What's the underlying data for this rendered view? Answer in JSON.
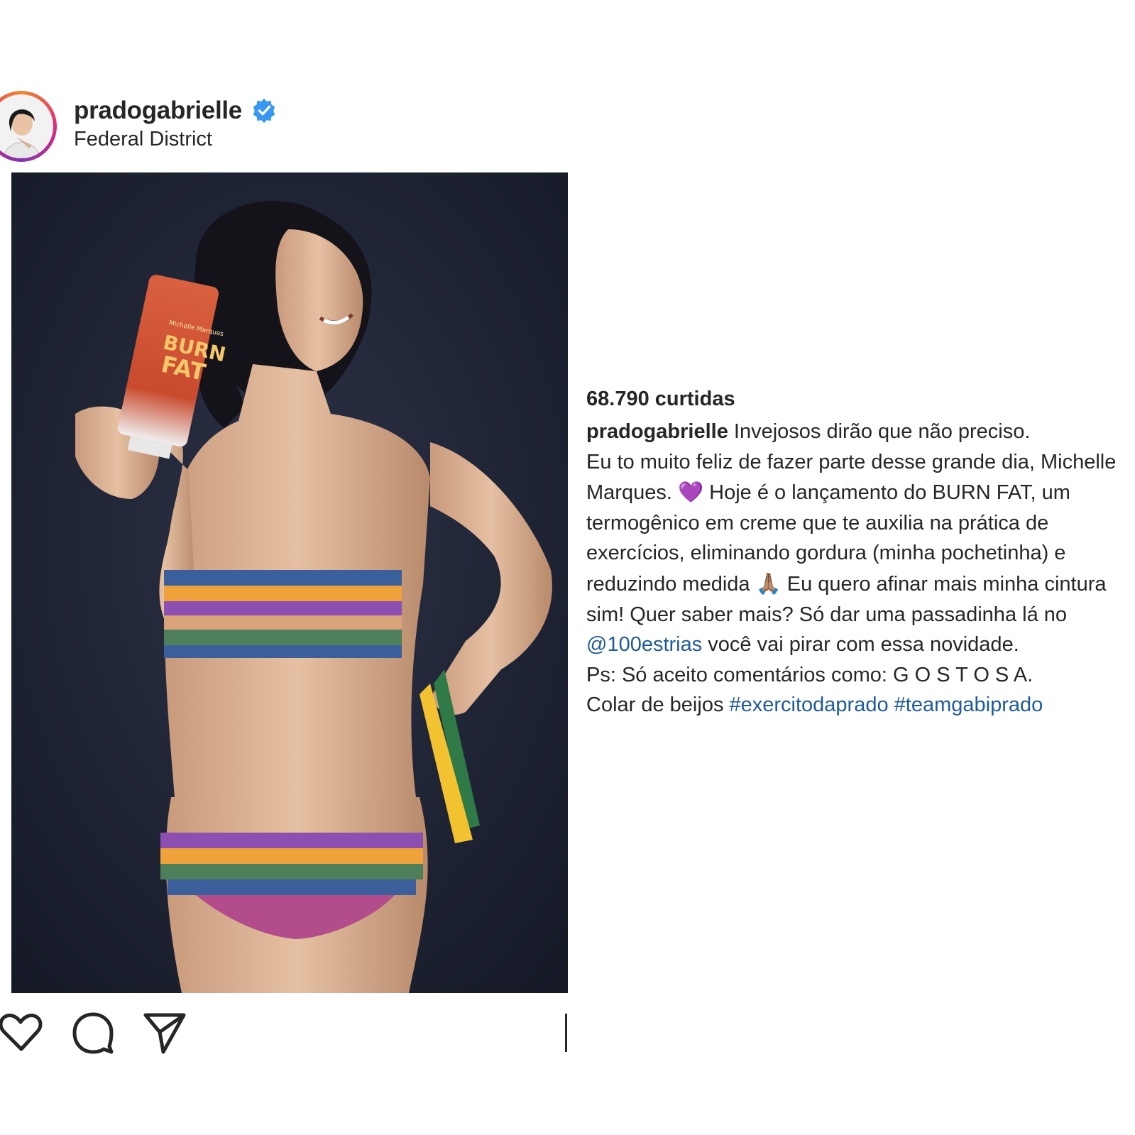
{
  "post": {
    "username": "pradogabrielle",
    "location": "Federal District",
    "verified": true,
    "likes": "68.790 curtidas",
    "caption": {
      "user": "pradogabrielle",
      "line1": " Invejosos dirão que não preciso.",
      "line2": "Eu to muito feliz de fazer parte desse grande dia, Michelle Marques. ",
      "heart_emoji": "💜",
      "line3": " Hoje é o lançamento do BURN FAT, um termogênico em creme que te auxilia na prática de exercícios, eliminando gordura (minha pochetinha) e reduzindo medida ",
      "pray_emoji": "🙏🏽",
      "line4": " Eu quero afinar mais minha cintura sim! Quer saber mais? Só dar uma passadinha lá no ",
      "mention": "@100estrias",
      "line5": " você vai pirar com essa novidade.",
      "line6": "Ps: Só aceito comentários como: G O S T O S A.",
      "line7_prefix": "Colar de beijos ",
      "hashtag1": "#exercitodaprado",
      "hashtag2": "#teamgabiprado"
    },
    "product_text": {
      "brand": "Michelle Marques",
      "name_line1": "BURN",
      "name_line2": "FAT"
    }
  },
  "icons": [
    "like-icon",
    "comment-icon",
    "share-icon",
    "verified-icon"
  ],
  "colors": {
    "link": "#1e5a9c",
    "verified": "#3897f0",
    "text": "#262626"
  }
}
